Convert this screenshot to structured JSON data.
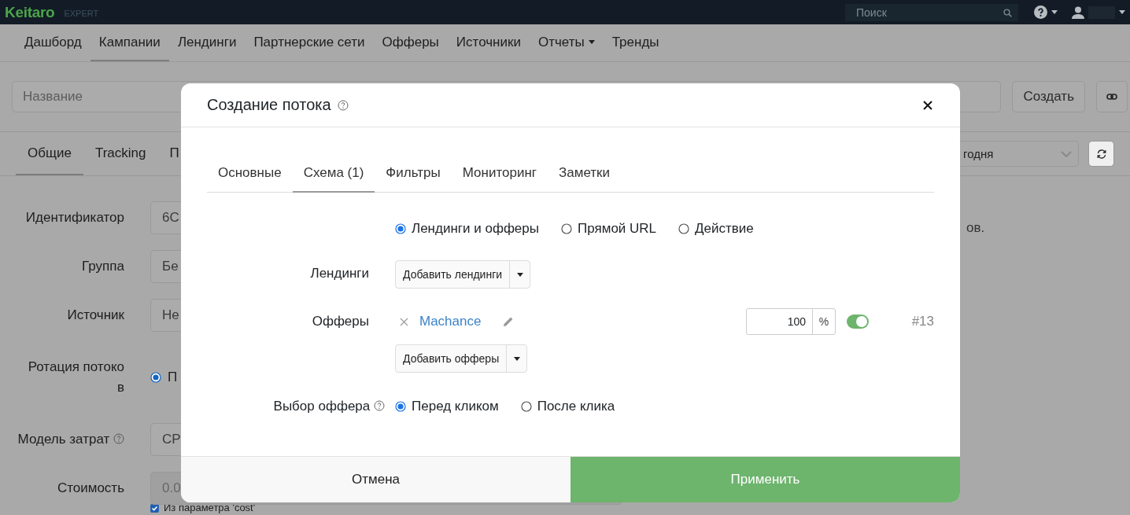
{
  "app": {
    "logo": "Keitaro",
    "edition": "EXPERT",
    "search": {
      "placeholder": "Поиск"
    }
  },
  "nav": [
    {
      "label": "Дашборд",
      "selected": false,
      "dropdown": false
    },
    {
      "label": "Кампании",
      "selected": true,
      "dropdown": false
    },
    {
      "label": "Лендинги",
      "selected": false,
      "dropdown": false
    },
    {
      "label": "Партнерские сети",
      "selected": false,
      "dropdown": false
    },
    {
      "label": "Офферы",
      "selected": false,
      "dropdown": false
    },
    {
      "label": "Источники",
      "selected": false,
      "dropdown": false
    },
    {
      "label": "Отчеты",
      "selected": false,
      "dropdown": true
    },
    {
      "label": "Тренды",
      "selected": false,
      "dropdown": false
    }
  ],
  "campaign_bar": {
    "name_field": {
      "placeholder": "Название"
    },
    "create_button": "Создать"
  },
  "campaign_tabs": [
    {
      "label": "Общие",
      "selected": true
    },
    {
      "label": "Tracking",
      "selected": false
    },
    {
      "label": "П",
      "selected": false
    }
  ],
  "date_select": {
    "value": "годня"
  },
  "side_note": "ов.",
  "form_rows": [
    {
      "label": "Идентификатор",
      "kind": "input",
      "value": "6С",
      "help": false,
      "disabled": false
    },
    {
      "label": "Группа",
      "kind": "input",
      "value": "Бе",
      "help": false,
      "disabled": false
    },
    {
      "label": "Источник",
      "kind": "input",
      "value": "Не",
      "help": false,
      "disabled": false
    },
    {
      "label": "Ротация потоков",
      "kind": "radio",
      "value": "П",
      "checked": true,
      "help": false
    },
    {
      "label": "Модель затрат",
      "kind": "input",
      "value": "CP",
      "help": true,
      "disabled": false
    },
    {
      "label": "Стоимость",
      "kind": "input",
      "value": "0.0",
      "help": false,
      "disabled": true
    }
  ],
  "cost_param": {
    "label": "Из параметра 'cost'",
    "checked": true
  },
  "modal": {
    "title": "Создание потока",
    "help": true,
    "tabs": [
      {
        "label": "Основные",
        "selected": false
      },
      {
        "label": "Схема (1)",
        "selected": true
      },
      {
        "label": "Фильтры",
        "selected": false
      },
      {
        "label": "Мониторинг",
        "selected": false
      },
      {
        "label": "Заметки",
        "selected": false
      }
    ],
    "scheme_options": [
      {
        "label": "Лендинги и офферы",
        "selected": true
      },
      {
        "label": "Прямой URL",
        "selected": false
      },
      {
        "label": "Действие",
        "selected": false
      }
    ],
    "landings": {
      "label": "Лендинги",
      "button": "Добавить лендинги"
    },
    "offers": {
      "label": "Офферы",
      "items": [
        {
          "name": "Machance",
          "share": "100",
          "unit": "%",
          "on": true,
          "id": "#13"
        }
      ],
      "button": "Добавить офферы"
    },
    "offer_selection": {
      "label": "Выбор оффера",
      "help": true,
      "options": [
        {
          "label": "Перед кликом",
          "selected": true
        },
        {
          "label": "После клика",
          "selected": false
        }
      ]
    },
    "cancel": "Отмена",
    "apply": "Применить"
  }
}
